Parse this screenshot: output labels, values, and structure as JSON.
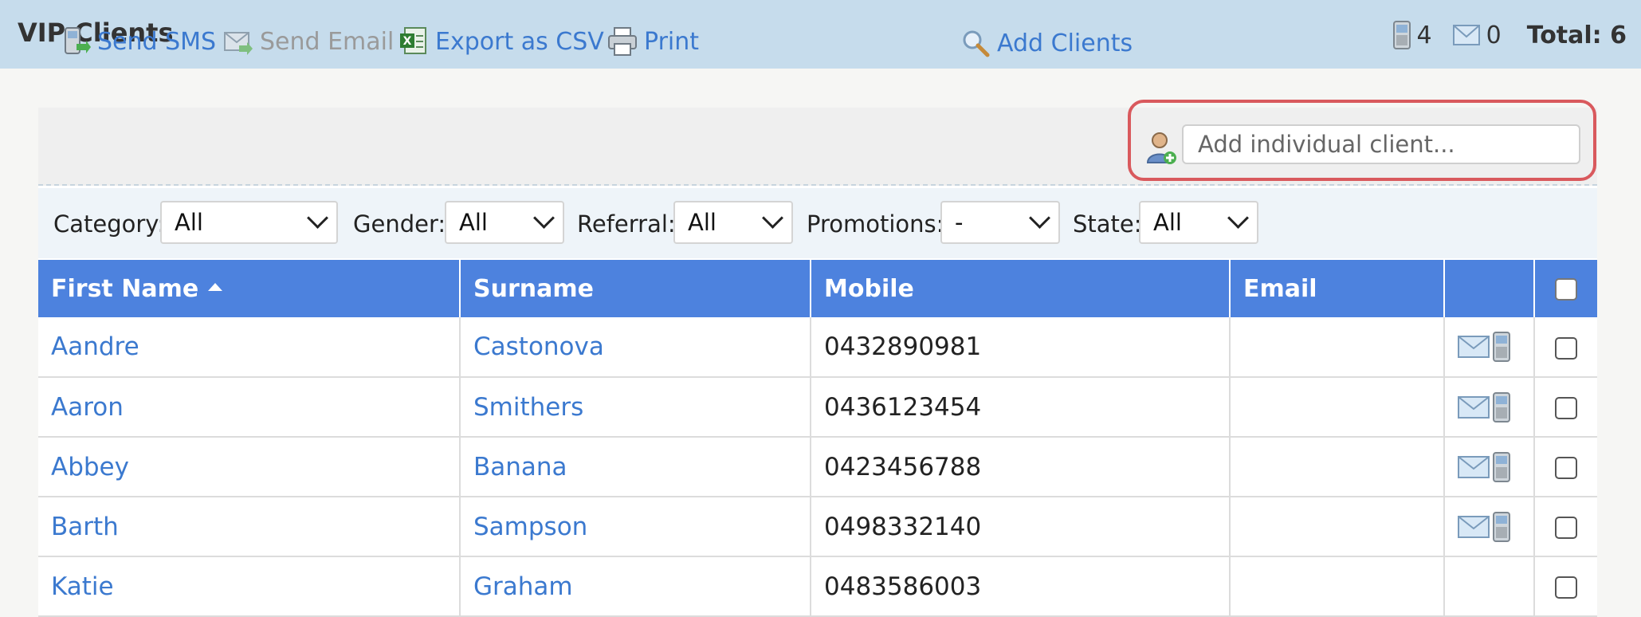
{
  "header": {
    "title": "VIP Clients",
    "sms_count": "4",
    "email_count": "0",
    "total": "Total: 6"
  },
  "toolbar": {
    "send_sms": "Send SMS",
    "send_email": "Send Email",
    "export_csv": "Export as CSV",
    "print": "Print",
    "add_clients": "Add Clients",
    "add_individual_placeholder": "Add individual client..."
  },
  "filters": {
    "category_label": "Category:",
    "category_value": "All",
    "gender_label": "Gender:",
    "gender_value": "All",
    "referral_label": "Referral:",
    "referral_value": "All",
    "promotions_label": "Promotions:",
    "promotions_value": "-",
    "state_label": "State:",
    "state_value": "All"
  },
  "table": {
    "columns": {
      "first_name": "First Name",
      "surname": "Surname",
      "mobile": "Mobile",
      "email": "Email"
    },
    "rows": [
      {
        "first": "Aandre",
        "surname": "Castonova",
        "mobile": "0432890981",
        "email": ""
      },
      {
        "first": "Aaron",
        "surname": "Smithers",
        "mobile": "0436123454",
        "email": ""
      },
      {
        "first": "Abbey",
        "surname": "Banana",
        "mobile": "0423456788",
        "email": ""
      },
      {
        "first": "Barth",
        "surname": "Sampson",
        "mobile": "0498332140",
        "email": ""
      },
      {
        "first": "Katie",
        "surname": "Graham",
        "mobile": "0483586003",
        "email": ""
      }
    ]
  },
  "colors": {
    "header_bg": "#c6dcec",
    "table_header_bg": "#4d82de",
    "link": "#3b79cf",
    "highlight": "#d9595d"
  }
}
